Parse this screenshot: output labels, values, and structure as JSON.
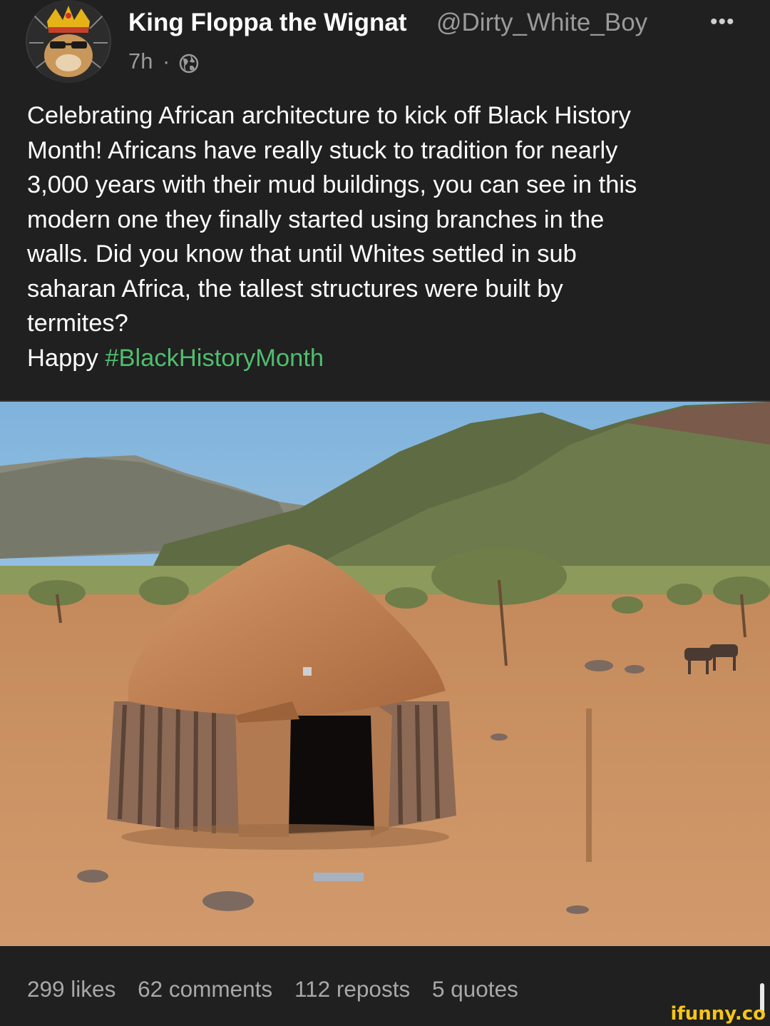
{
  "author": {
    "name": "King Floppa the Wignat",
    "handle": "@Dirty_White_Boy",
    "time": "7h",
    "separator": "·"
  },
  "post": {
    "lines": [
      "Celebrating African architecture to kick off Black History",
      "Month! Africans have really stuck to tradition for nearly",
      "3,000 years with their mud buildings, you can see in this",
      "modern one they finally started using branches in the",
      "walls. Did you know that until Whites settled in sub",
      "saharan Africa, the tallest structures were built by",
      "termites?"
    ],
    "last_line_prefix": "Happy ",
    "hashtag": "#BlackHistoryMonth",
    "image_alt": "mud hut with branch walls in arid landscape with mountains"
  },
  "stats": {
    "likes": "299 likes",
    "comments": "62 comments",
    "reposts": "112 reposts",
    "quotes": "5 quotes"
  },
  "watermark": "ifunny.co",
  "icons": {
    "more": "more-options-icon",
    "globe": "globe-icon"
  },
  "colors": {
    "background": "#202020",
    "hashtag": "#4fbe6e",
    "muted": "#9a9a9a"
  }
}
